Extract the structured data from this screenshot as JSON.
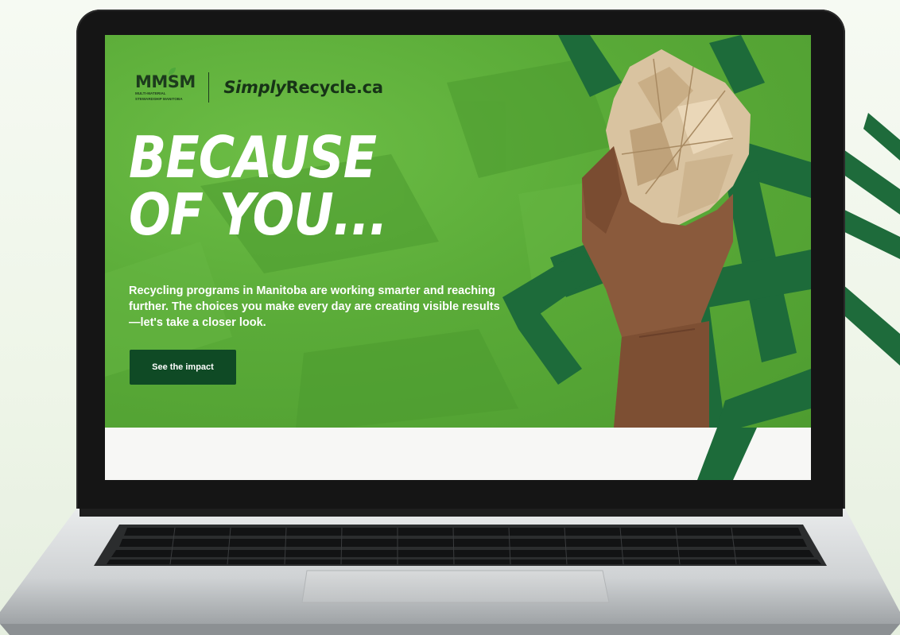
{
  "colors": {
    "hero_green": "#5aab38",
    "dark_green": "#1d6b3a",
    "button_green": "#0f4a25",
    "text_white": "#ffffff"
  },
  "logo": {
    "mmsm_text": "MMSM",
    "mmsm_subtitle_line1": "MULTI-MATERIAL",
    "mmsm_subtitle_line2": "STEWARDSHIP MANITOBA",
    "site_italic": "Simply",
    "site_rest": "Recycle.ca"
  },
  "hero": {
    "headline_line1": "BECAUSE",
    "headline_line2": "OF YOU...",
    "body": "Recycling programs in Manitoba are working smarter and reaching further. The choices you make every day are creating visible results—let's take a closer look.",
    "cta_label": "See the impact"
  },
  "icons": {
    "leaf": "leaf-icon",
    "hand_with_paper": "hand-holding-paper-image",
    "brush_strokes": "brush-stroke-decoration"
  }
}
